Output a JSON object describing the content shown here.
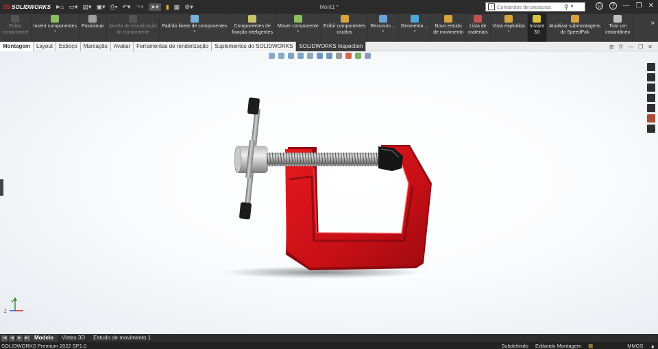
{
  "app": {
    "logo_ds": "3S",
    "logo_name": "SOLIDWORKS",
    "document_title": "Mont1 *"
  },
  "search": {
    "placeholder": "Comandos de pesquisa"
  },
  "commands": [
    {
      "label": "Editar\ncomponente",
      "disabled": true,
      "color": "#7a7a7a"
    },
    {
      "label": "Inserir componentes",
      "caret": true,
      "color": "#8cbf5e"
    },
    {
      "label": "Posicionar",
      "color": "#a0a0a0"
    },
    {
      "label": "Janela de visualização\ndo componente",
      "disabled": true,
      "color": "#7a7a7a"
    },
    {
      "label": "Padrão linear de componentes",
      "caret": true,
      "color": "#7ab0d8"
    },
    {
      "label": "Componentes de\nfixação inteligentes",
      "color": "#c9c46a"
    },
    {
      "label": "Mover componente",
      "caret": true,
      "color": "#8cbf5e"
    },
    {
      "label": "Exibir componentes\nocultos",
      "color": "#d9a33e"
    },
    {
      "label": "Recursos ...",
      "caret": true,
      "color": "#6aa2d8"
    },
    {
      "label": "Geometria ...",
      "caret": true,
      "color": "#4fa8d8"
    },
    {
      "label": "Novo estudo\nde movimento",
      "color": "#d9a33e"
    },
    {
      "label": "Lista de\nmateriais",
      "color": "#c85050"
    },
    {
      "label": "Vista explodida",
      "caret": true,
      "color": "#d9a33e"
    },
    {
      "label": "Instant\n3D",
      "active": true,
      "color": "#d9c23e"
    },
    {
      "label": "Atualizar submontagens\ndo SpeedPak",
      "color": "#d9a33e"
    },
    {
      "label": "Tirar um\ninstantâneo",
      "color": "#bfbfbf"
    }
  ],
  "tabs": [
    "Montagem",
    "Layout",
    "Esboço",
    "Marcação",
    "Avaliar",
    "Ferramentas de renderização",
    "Suplementos do SOLIDWORKS",
    "SOLIDWORKS Inspection"
  ],
  "bottom_tabs": [
    "Modelo",
    "Vistas 3D",
    "Estudo de movimento 1"
  ],
  "status": {
    "product": "SOLIDWORKS Premium 2022 SP1.0",
    "definition": "Subdefinido",
    "mode": "Editando Montagem",
    "units": "MMGS"
  },
  "triad": {
    "y": "Y",
    "z": "Z"
  },
  "colors": {
    "clamp_red": "#c9101a",
    "screw_gray": "#8c8c8c",
    "cap_black": "#1a1a1a",
    "ui_dark": "#3b3b3b"
  }
}
